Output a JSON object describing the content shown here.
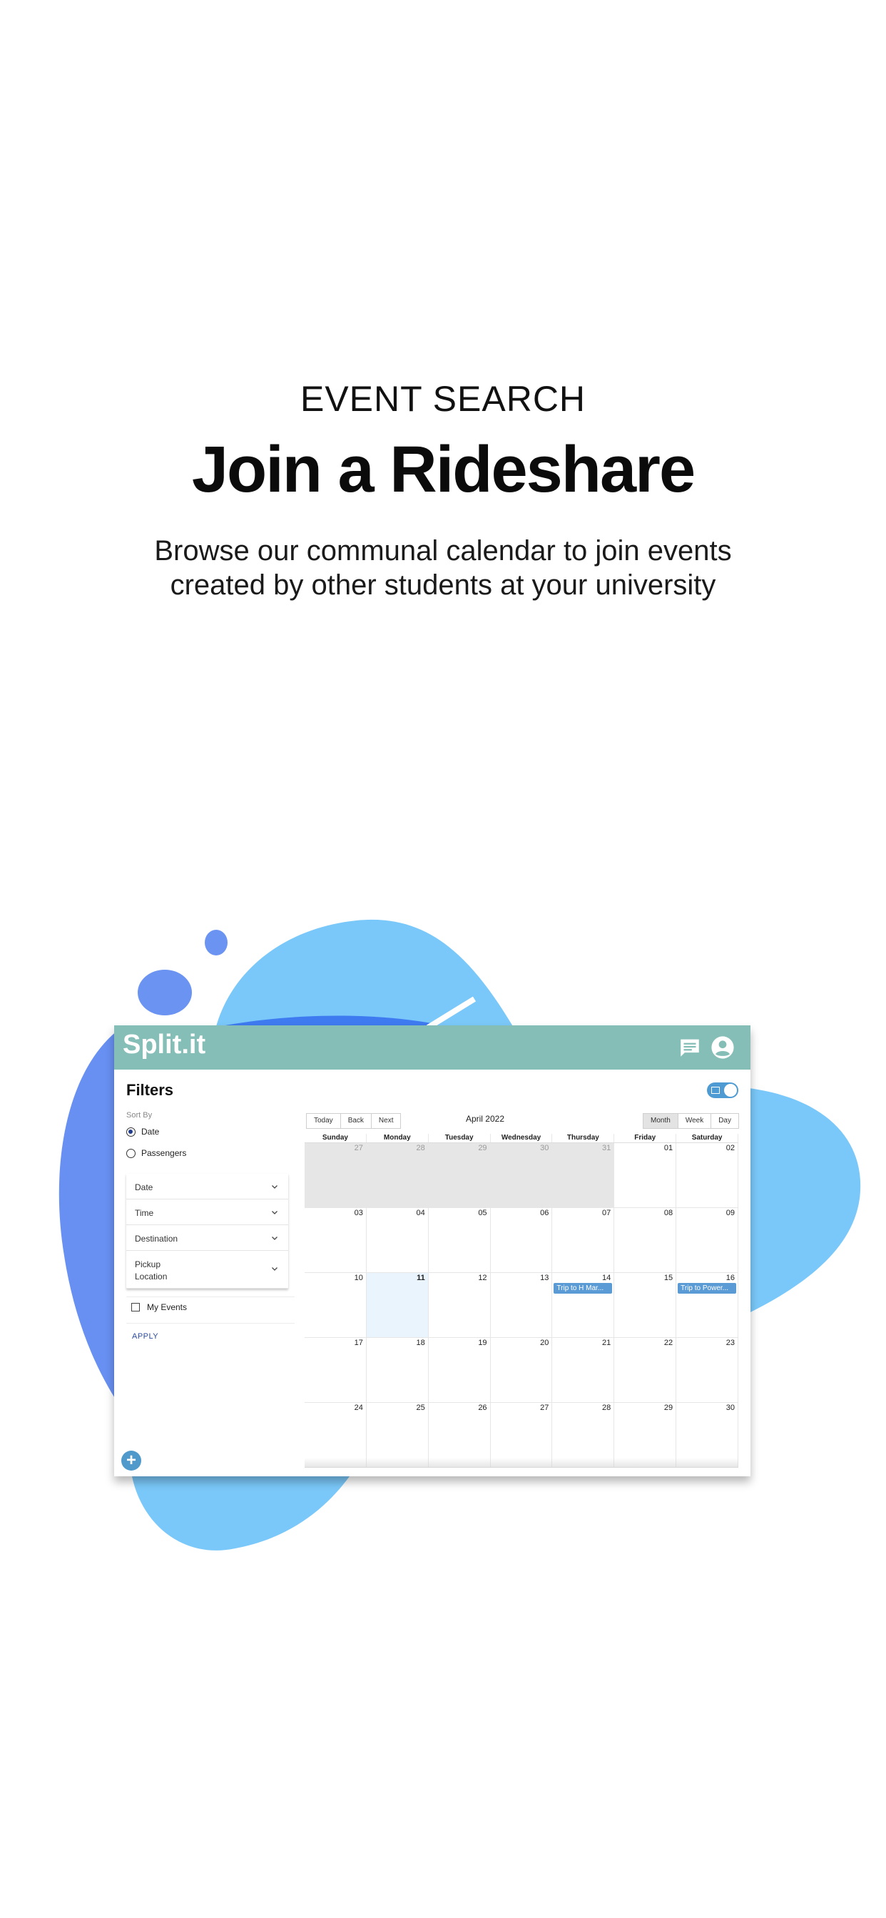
{
  "hero": {
    "eyebrow": "EVENT SEARCH",
    "title": "Join a Rideshare",
    "subtitle_line1": "Browse our communal calendar to join events",
    "subtitle_line2": "created by other students at your university"
  },
  "app": {
    "logo": "Split.it",
    "header_icons": [
      "chat-icon",
      "account-icon"
    ],
    "colors": {
      "header": "#85bdb7",
      "accent": "#4f9acb",
      "event": "#5b9bd5"
    }
  },
  "filters": {
    "title": "Filters",
    "sort_by_label": "Sort By",
    "sort_options": [
      "Date",
      "Passengers"
    ],
    "sort_selected": "Date",
    "dropdowns": [
      "Date",
      "Time",
      "Destination",
      "Pickup Location"
    ],
    "my_events_label": "My Events",
    "apply_label": "APPLY"
  },
  "calendar": {
    "toolbar_left": [
      "Today",
      "Back",
      "Next"
    ],
    "label": "April 2022",
    "views": [
      "Month",
      "Week",
      "Day"
    ],
    "active_view": "Month",
    "weekdays": [
      "Sunday",
      "Monday",
      "Tuesday",
      "Wednesday",
      "Thursday",
      "Friday",
      "Saturday"
    ],
    "days": [
      "27",
      "28",
      "29",
      "30",
      "31",
      "01",
      "02",
      "03",
      "04",
      "05",
      "06",
      "07",
      "08",
      "09",
      "10",
      "11",
      "12",
      "13",
      "14",
      "15",
      "16",
      "17",
      "18",
      "19",
      "20",
      "21",
      "22",
      "23",
      "24",
      "25",
      "26",
      "27",
      "28",
      "29",
      "30"
    ],
    "off_range_count": 5,
    "today_index": 15,
    "events": [
      {
        "day_index": 18,
        "label": "Trip to H Mar..."
      },
      {
        "day_index": 20,
        "label": "Trip to Power..."
      }
    ]
  }
}
